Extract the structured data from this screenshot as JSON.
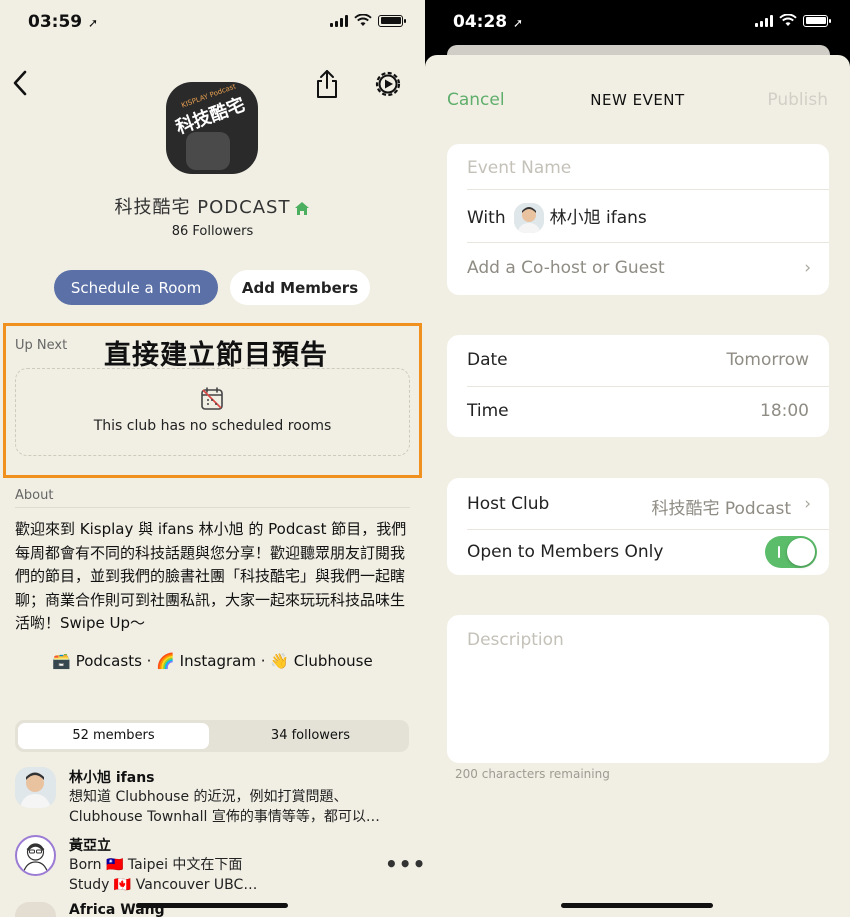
{
  "left": {
    "status": {
      "time": "03:59"
    },
    "club": {
      "name": "科技酷宅 PODCAST",
      "followers": "86 Followers",
      "avatar_caption": "科技酷宅",
      "avatar_tag": "KISPLAY Podcast"
    },
    "actions": {
      "schedule": "Schedule a Room",
      "add_members": "Add Members"
    },
    "up_next": {
      "label": "Up Next",
      "overlay_text": "直接建立節目預告",
      "empty_text": "This club has no scheduled rooms"
    },
    "about": {
      "label": "About",
      "text": "歡迎來到 Kisplay 與 ifans 林小旭 的 Podcast 節目，我們每周都會有不同的科技話題與您分享！歡迎聽眾朋友訂閱我們的節目，並到我們的臉書社團「科技酷宅」與我們一起瞎聊；商業合作則可到社團私訊，大家一起來玩玩科技品味生活喲！Swipe Up～"
    },
    "links": {
      "podcasts": "🗃️ Podcasts",
      "instagram": "🌈 Instagram",
      "clubhouse": "👋 Clubhouse",
      "separator": "·"
    },
    "tabs": {
      "members": "52 members",
      "followers": "34 followers"
    },
    "members": [
      {
        "name": "林小旭 ifans",
        "bio1": "想知道 Clubhouse 的近況，例如打賞問題、",
        "bio2": "Clubhouse Townhall 宣佈的事情等等，都可以…"
      },
      {
        "name": "黃亞立",
        "bio1": "Born 🇹🇼 Taipei  中文在下面",
        "bio2": "Study 🇨🇦 Vancouver UBC…"
      },
      {
        "name": "Africa Wang"
      }
    ],
    "more": "•••"
  },
  "right": {
    "status": {
      "time": "04:28"
    },
    "header": {
      "cancel": "Cancel",
      "title": "NEW EVENT",
      "publish": "Publish"
    },
    "event_name_placeholder": "Event Name",
    "with_label": "With",
    "with_name": "林小旭 ifans",
    "cohost_label": "Add a Co-host or Guest",
    "date_label": "Date",
    "date_value": "Tomorrow",
    "time_label": "Time",
    "time_value": "18:00",
    "host_club_label": "Host Club",
    "host_club_value": "科技酷宅 Podcast",
    "members_only_label": "Open to Members Only",
    "members_only_on": true,
    "description_placeholder": "Description",
    "remaining": "200 characters remaining"
  },
  "colors": {
    "background": "#f1efe4",
    "accent_blue": "#5a70a6",
    "highlight_orange": "#f0901e",
    "green": "#5fae6c",
    "toggle_green": "#5bbd6a"
  },
  "icons": [
    "location-arrow-icon",
    "signal-icon",
    "wifi-icon",
    "battery-icon",
    "back-chevron-icon",
    "share-icon",
    "gear-icon",
    "house-icon",
    "calendar-off-icon",
    "chevron-right-icon",
    "toggle-switch"
  ]
}
